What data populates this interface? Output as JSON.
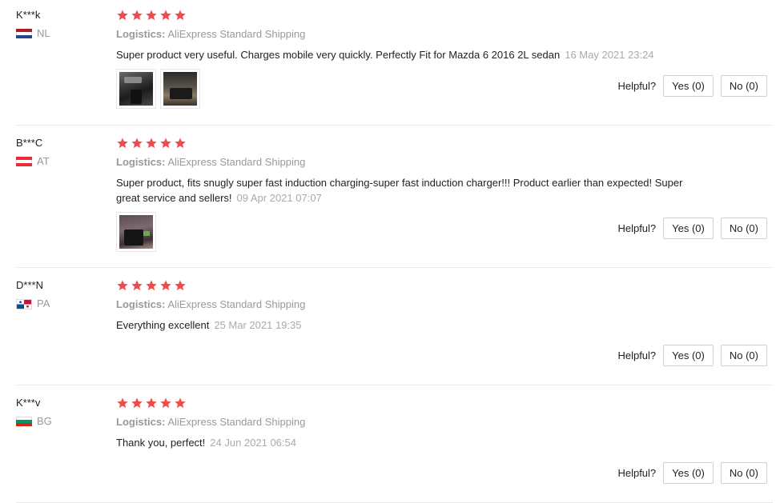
{
  "helpful_label": "Helpful?",
  "reviews": [
    {
      "user": "K***k",
      "country": "NL",
      "flag": [
        "#ae1c28",
        "#ffffff",
        "#21468b"
      ],
      "stars": 5,
      "logistics_label": "Logistics:",
      "logistics_value": "AliExpress Standard Shipping",
      "comment": "Super product very useful. Charges mobile very quickly. Perfectly Fit for Mazda 6 2016 2L sedan",
      "date": "16 May 2021 23:24",
      "photos": [
        "car-interior-photo",
        "car-interior-photo"
      ],
      "yes": "Yes (0)",
      "no": "No (0)"
    },
    {
      "user": "B***C",
      "country": "AT",
      "flag": [
        "#ed2939",
        "#ffffff",
        "#ed2939"
      ],
      "stars": 5,
      "logistics_label": "Logistics:",
      "logistics_value": "AliExpress Standard Shipping",
      "comment": "Super product, fits snugly super fast induction charging-super fast induction charger!!! Product earlier than expected! Super great service and sellers!",
      "date": "09 Apr 2021 07:07",
      "photos": [
        "charger-photo"
      ],
      "yes": "Yes (0)",
      "no": "No (0)"
    },
    {
      "user": "D***N",
      "country": "PA",
      "flag": [
        "#ffffff",
        "#d21034",
        "#005293"
      ],
      "stars": 5,
      "logistics_label": "Logistics:",
      "logistics_value": "AliExpress Standard Shipping",
      "comment": "Everything excellent",
      "date": "25 Mar 2021 19:35",
      "photos": [],
      "yes": "Yes (0)",
      "no": "No (0)"
    },
    {
      "user": "K***v",
      "country": "BG",
      "flag": [
        "#ffffff",
        "#00966e",
        "#d62612"
      ],
      "stars": 5,
      "logistics_label": "Logistics:",
      "logistics_value": "AliExpress Standard Shipping",
      "comment": "Thank you, perfect!",
      "date": "24 Jun 2021 06:54",
      "photos": [],
      "yes": "Yes (0)",
      "no": "No (0)"
    }
  ],
  "colors": {
    "star": "#f04b4b",
    "divider": "#e8e8e8"
  }
}
